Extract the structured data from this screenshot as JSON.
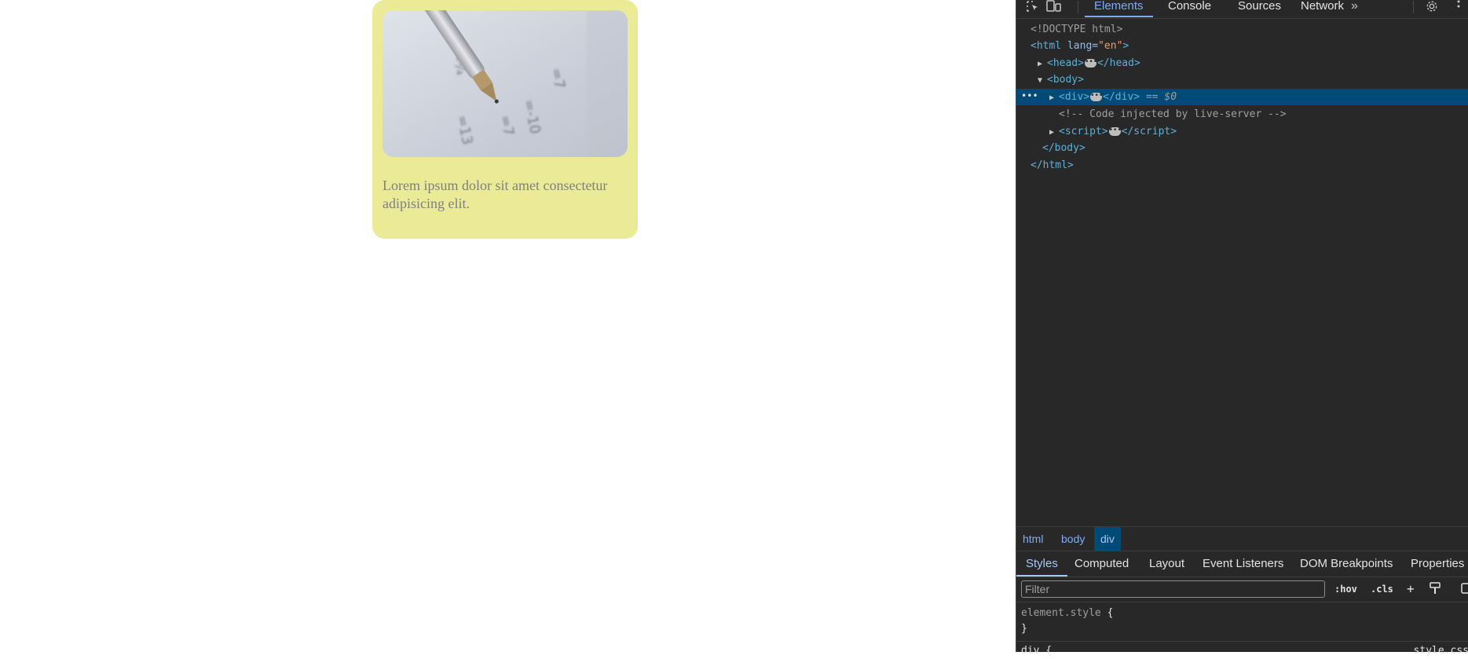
{
  "card": {
    "text": "Lorem ipsum dolor sit amet consectetur adipisicing elit.",
    "background_color": "#eaea97"
  },
  "devtools": {
    "toolbar": {
      "tabs": [
        "Elements",
        "Console",
        "Sources",
        "Network"
      ],
      "active_tab": "Elements",
      "more_tabs_glyph": "»"
    },
    "dom": {
      "doctype": "<!DOCTYPE html>",
      "html_tag": "html",
      "html_attr_name": "lang",
      "html_attr_value": "\"en\"",
      "head_tag": "head",
      "body_tag": "body",
      "div_tag": "div",
      "selected_marker": "== $0",
      "comment": "<!-- Code injected by live-server -->",
      "script_tag": "script"
    },
    "breadcrumbs": [
      "html",
      "body",
      "div"
    ],
    "panel_tabs": [
      "Styles",
      "Computed",
      "Layout",
      "Event Listeners",
      "DOM Breakpoints",
      "Properties"
    ],
    "active_panel_tab": "Styles",
    "filter": {
      "placeholder": "Filter",
      "hov_label": ":hov",
      "cls_label": ".cls"
    },
    "styles": {
      "element_style_selector": "element.style",
      "open_brace": "{",
      "close_brace": "}",
      "next_rule_selector": "div {",
      "next_rule_source": "style.css"
    }
  }
}
